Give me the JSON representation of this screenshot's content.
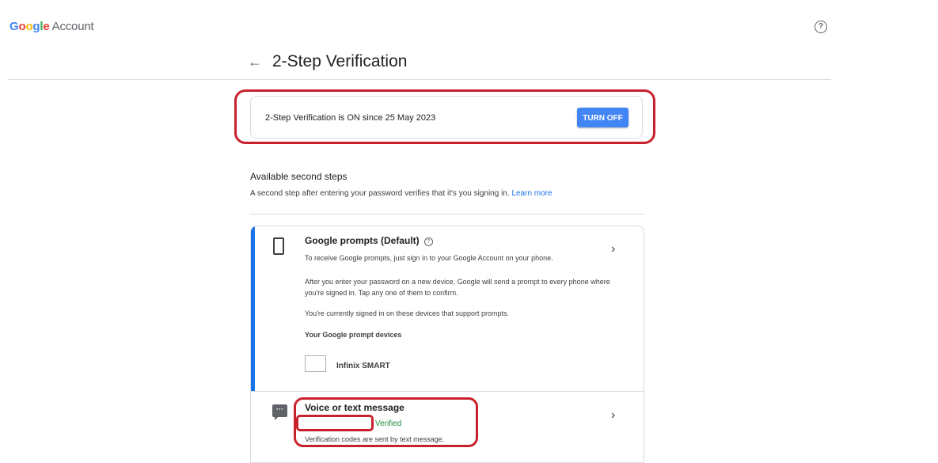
{
  "header": {
    "logo_google": "Google",
    "logo_account": "Account",
    "help_icon": "help-circle-icon"
  },
  "page": {
    "title": "2-Step Verification",
    "back_icon": "arrow-left-icon"
  },
  "status": {
    "text": "2-Step Verification is ON since 25 May 2023",
    "button_label": "TURN OFF"
  },
  "second_steps": {
    "title": "Available second steps",
    "description": "A second step after entering your password verifies that it's you signing in.",
    "learn_more": "Learn more",
    "methods": [
      {
        "icon": "phone-icon",
        "title": "Google prompts (Default)",
        "info_icon": "help-circle-icon",
        "lines": [
          "To receive Google prompts, just sign in to your Google Account on your phone.",
          "After you enter your password on a new device, Google will send a prompt to every phone where you're signed in. Tap any one of them to confirm.",
          "You're currently signed in on these devices that support prompts.",
          "Your Google prompt devices"
        ],
        "devices": [
          "Infinix SMART"
        ]
      },
      {
        "icon": "message-icon",
        "title": "Voice or text message",
        "status": "Verified",
        "description": "Verification codes are sent by text message."
      }
    ]
  },
  "colors": {
    "accent": "#1a73e8",
    "button": "#4285f4",
    "verified": "#1e8e3e",
    "highlight": "#c8212d"
  }
}
